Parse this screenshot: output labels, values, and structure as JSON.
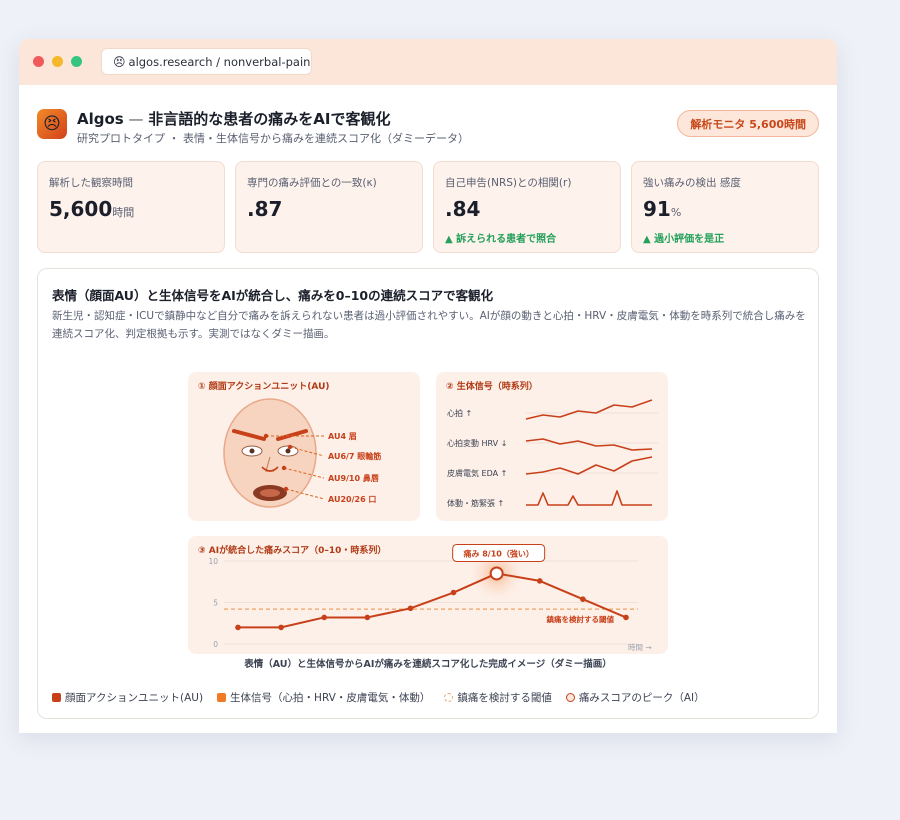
{
  "browser": {
    "url": "algos.research / nonverbal-pain",
    "url_icon": "😣"
  },
  "header": {
    "logo_emoji": "😣",
    "title_brand": "Algos",
    "title_sep": " — ",
    "title_main": "非言語的な患者の痛みをAIで客観化",
    "subtitle": "研究プロトタイプ ・ 表情・生体信号から痛みを連続スコア化（ダミーデータ）",
    "badge": "解析モニタ 5,600時間"
  },
  "kpis": [
    {
      "label": "解析した観察時間",
      "value": "5,600",
      "unit": "時間",
      "note": ""
    },
    {
      "label": "専門の痛み評価との一致(κ)",
      "value": ".87",
      "unit": "",
      "note": ""
    },
    {
      "label": "自己申告(NRS)との相関(r)",
      "value": ".84",
      "unit": "",
      "note": "▲ 訴えられる患者で照合"
    },
    {
      "label": "強い痛みの検出 感度",
      "value": "91",
      "unit": "%",
      "note": "▲ 過小評価を是正"
    }
  ],
  "panel": {
    "title": "表情（顔面AU）と生体信号をAIが統合し、痛みを0–10の連続スコアで客観化",
    "desc": "新生児・認知症・ICUで鎮静中など自分で痛みを訴えられない患者は過小評価されやすい。AIが顔の動きと心拍・HRV・皮膚電気・体動を時系列で統合し痛みを連続スコア化、判定根拠も示す。実測ではなくダミー描画。"
  },
  "figure": {
    "au_panel_title": "① 顔面アクションユニット(AU)",
    "au_labels": [
      "AU4 眉",
      "AU6/7 眼輪筋",
      "AU9/10 鼻唇",
      "AU20/26 口"
    ],
    "bio_panel_title": "② 生体信号（時系列）",
    "bio_labels": [
      "心拍 ↑",
      "心拍変動 HRV ↓",
      "皮膚電気 EDA ↑",
      "体動・筋緊張 ↑"
    ],
    "score_panel_title": "③ AIが統合した痛みスコア（0–10・時系列）",
    "peak_label": "痛み 8/10（強い）",
    "threshold_label": "鎮痛を検討する閾値",
    "time_label": "時間 →",
    "caption": "表情（AU）と生体信号からAIが痛みを連続スコア化した完成イメージ（ダミー描画）"
  },
  "chart_data": {
    "type": "line",
    "title": "③ AIが統合した痛みスコア（0–10・時系列）",
    "xlabel": "時間 →",
    "ylabel": "",
    "ylim": [
      0,
      10
    ],
    "yticks": [
      0,
      5,
      10
    ],
    "series": [
      {
        "values": [
          2,
          2,
          3.2,
          3.2,
          4.3,
          6.2,
          8.5,
          7.6,
          5.4,
          3.2
        ]
      }
    ],
    "threshold": 4.2,
    "peak": {
      "index": 6,
      "value": 8.5,
      "label": "痛み 8/10（強い）"
    }
  },
  "legend": [
    {
      "label": "顔面アクションユニット(AU)",
      "type": "au"
    },
    {
      "label": "生体信号（心拍・HRV・皮膚電気・体動）",
      "type": "bio"
    },
    {
      "label": "鎮痛を検討する閾値",
      "type": "thr"
    },
    {
      "label": "痛みスコアのピーク（AI）",
      "type": "peak"
    }
  ],
  "colors": {
    "accent": "#c8401a",
    "bio": "#f07a25",
    "panel_bg": "#fdf2ec",
    "ok": "#23a05a"
  }
}
